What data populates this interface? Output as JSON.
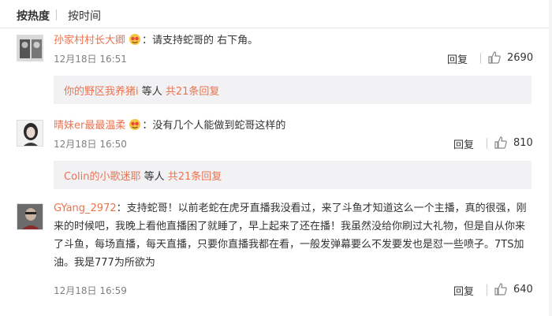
{
  "sort": {
    "hot": "按热度",
    "time": "按时间"
  },
  "comments": [
    {
      "user": "孙家村村长大卿",
      "text": "：请支持蛇哥的 右下角。",
      "time": "12月18日 16:51",
      "reply": "回复",
      "likes": "2690",
      "sub": {
        "user": "你的野区我养猪i",
        "etc": " 等人 ",
        "total": "共21条回复"
      }
    },
    {
      "user": "晴妹er最最温柔",
      "text": "：没有几个人能做到蛇哥这样的",
      "time": "12月18日 16:50",
      "reply": "回复",
      "likes": "810",
      "sub": {
        "user": "Colin的小歌迷耶",
        "etc": " 等人 ",
        "total": "共21条回复"
      }
    },
    {
      "user": "GYang_2972",
      "text": "：支持蛇哥！以前老蛇在虎牙直播我没看过，来了斗鱼才知道这么一个主播，真的很强，刚来的时候吧，我晚上看他直播困了就睡了，早上起来了还在播！我虽然没给你刷过大礼物，但是自从你来了斗鱼，每场直播，每天直播，只要你直播我都在看，一般发弹幕要么不发要发也是怼一些喷子。7TS加油。我是777为所欲为",
      "time": "12月18日 16:59",
      "reply": "回复",
      "likes": "640"
    }
  ],
  "colors": {
    "accent": "#eb7350",
    "sub_bg": "#f2f2f5",
    "text": "#333333",
    "time": "#808080"
  },
  "icons": {
    "vip": "vip-face-badge-icon",
    "like": "thumbs-up-icon"
  }
}
